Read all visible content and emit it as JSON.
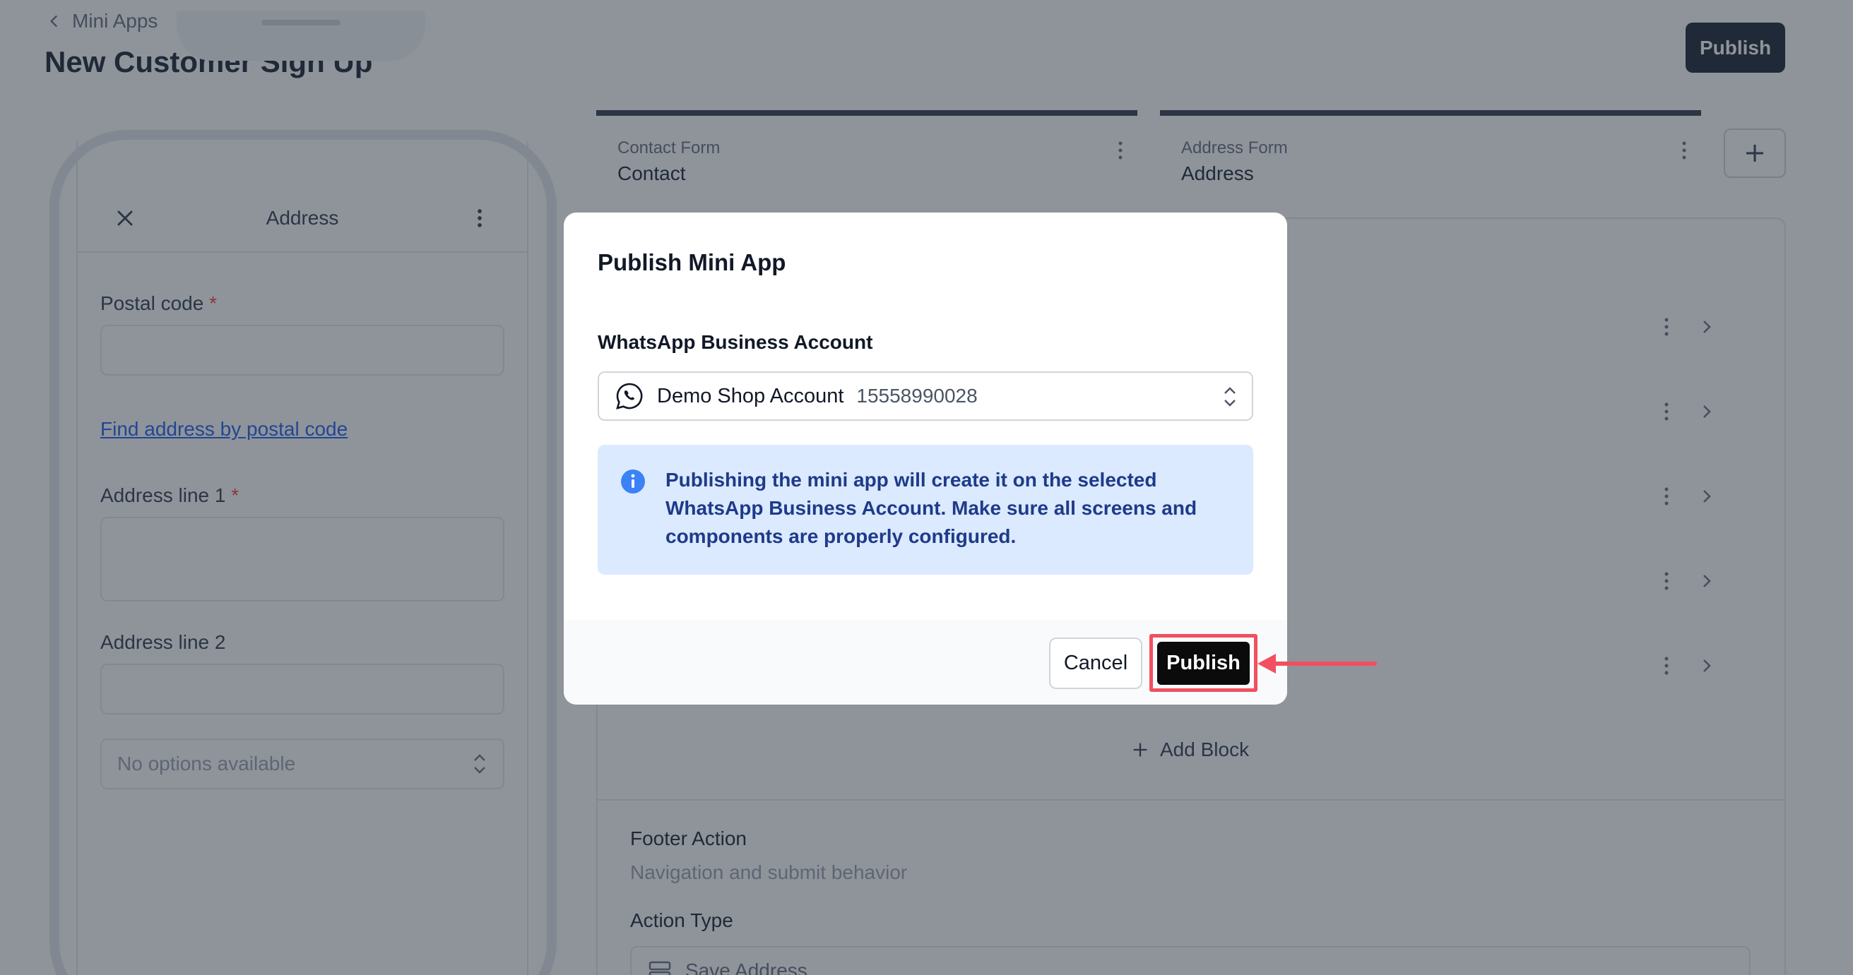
{
  "header": {
    "back_label": "Mini Apps",
    "page_title": "New Customer Sign Up",
    "publish_label": "Publish"
  },
  "phone": {
    "screen_title": "Address",
    "postal_code_label": "Postal code",
    "required_mark": "*",
    "find_address_link": "Find address by postal code",
    "address_line1_label": "Address line 1",
    "address_line2_label": "Address line 2",
    "select_placeholder": "No options available"
  },
  "tabs": [
    {
      "kind": "Contact Form",
      "name": "Contact"
    },
    {
      "kind": "Address Form",
      "name": "Address"
    }
  ],
  "editor": {
    "add_block_label": "Add Block",
    "footer_title": "Footer Action",
    "footer_subtitle": "Navigation and submit behavior",
    "action_type_label": "Action Type",
    "action_type_value": "Save Address"
  },
  "modal": {
    "title": "Publish Mini App",
    "account_label": "WhatsApp Business Account",
    "account_name": "Demo Shop Account",
    "account_number": "15558990028",
    "info_text": "Publishing the mini app will create it on the selected WhatsApp Business Account. Make sure all screens and components are properly configured.",
    "cancel_label": "Cancel",
    "publish_label": "Publish"
  },
  "colors": {
    "highlight": "#f0505f",
    "info_bg": "#dbeafe",
    "info_text": "#1e3a8a",
    "primary_button": "#0b0b0b"
  }
}
